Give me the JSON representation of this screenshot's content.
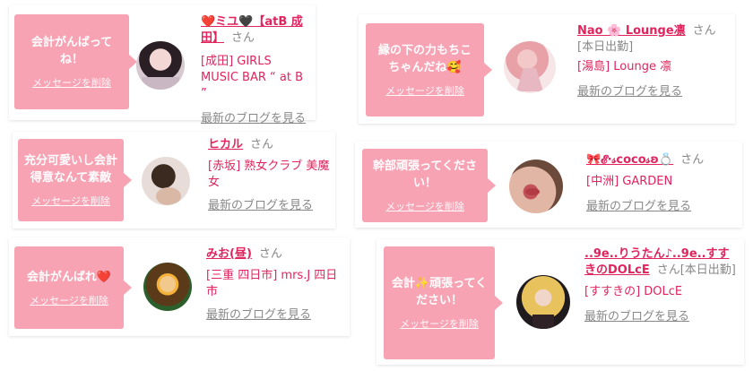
{
  "cards": [
    {
      "message": "会計がんばってね！",
      "delete_label": "メッセージを削除",
      "name": "❤️ミユ🖤【atB 成田】",
      "honorific": "さん",
      "shop": "[成田] GIRLS MUSIC BAR “ at B ”",
      "blog_link": "最新のブログを見る",
      "avatar_icon": "girl-avatar"
    },
    {
      "message": "充分可愛いし会計得意なんて素敵",
      "delete_label": "メッセージを削除",
      "name": "ヒカル",
      "honorific": "さん",
      "shop": "[赤坂] 熟女クラブ 美魔女",
      "blog_link": "最新のブログを見る",
      "avatar_icon": "woman-avatar"
    },
    {
      "message": "会計がんばれ❤️",
      "delete_label": "メッセージを削除",
      "name": "みお(昼)",
      "honorific": "さん",
      "shop": "[三重 四日市] mrs.J 四日市",
      "blog_link": "最新のブログを見る",
      "avatar_icon": "character-avatar"
    },
    {
      "message": "縁の下の力もちこちゃんだね🥰",
      "delete_label": "メッセージを削除",
      "name": "Nao 🌸 Lounge凛",
      "honorific": "さん[本日出勤]",
      "shop": "[湯島] Lounge 凛",
      "blog_link": "最新のブログを見る",
      "avatar_icon": "kimono-avatar"
    },
    {
      "message": "幹部頑張ってください！",
      "delete_label": "メッセージを削除",
      "name": "🎀𝓔·𝓈coco𝓈ʚ💍",
      "honorific": "さん",
      "shop": "[中洲] GARDEN",
      "blog_link": "最新のブログを見る",
      "avatar_icon": "lips-avatar"
    },
    {
      "message": "会計✨頑張ってください！",
      "delete_label": "メッセージを削除",
      "name": "..9e..りうたん♪..9e..すすきのDOLcE",
      "honorific": "さん[本日出勤]",
      "shop": "[すすきの] DOLcE",
      "blog_link": "最新のブログを見る",
      "avatar_icon": "blonde-avatar"
    }
  ],
  "colors": {
    "bubble": "#f7a3b4",
    "name": "#e0245e",
    "muted": "#888888"
  }
}
